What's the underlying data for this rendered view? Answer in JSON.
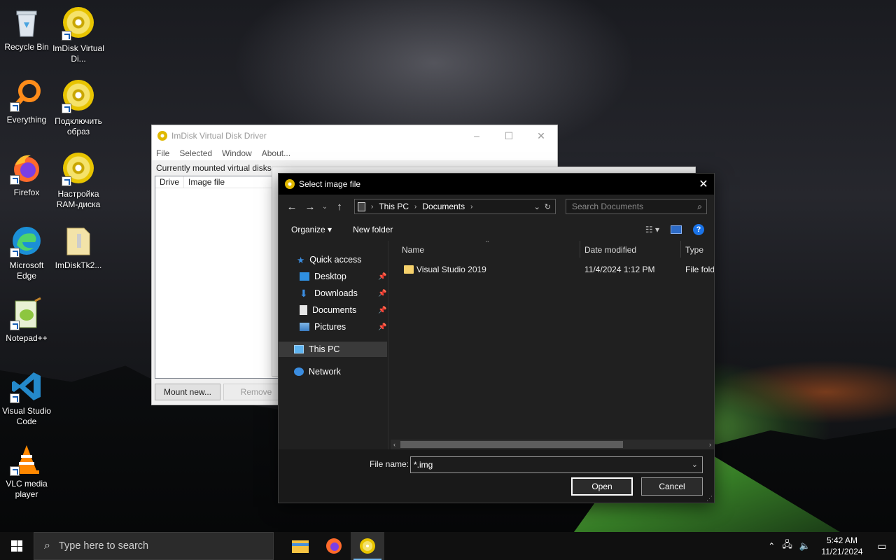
{
  "desktop_icons": [
    {
      "label": "Recycle Bin",
      "icon": "recycle-bin-icon"
    },
    {
      "label": "ImDisk Virtual Di...",
      "icon": "imdisk-disc-icon"
    },
    {
      "label": "Everything",
      "icon": "everything-icon"
    },
    {
      "label": "Подключить образ",
      "icon": "imdisk-disc-icon"
    },
    {
      "label": "Firefox",
      "icon": "firefox-icon"
    },
    {
      "label": "Настройка RAM-диска",
      "icon": "imdisk-disc-icon"
    },
    {
      "label": "Microsoft Edge",
      "icon": "edge-icon"
    },
    {
      "label": "ImDiskTk2...",
      "icon": "zip-folder-icon"
    },
    {
      "label": "Notepad++",
      "icon": "notepadpp-icon"
    },
    {
      "label": "Visual Studio Code",
      "icon": "vscode-icon"
    },
    {
      "label": "VLC media player",
      "icon": "vlc-icon"
    }
  ],
  "imdisk_window": {
    "title": "ImDisk Virtual Disk Driver",
    "menu": [
      "File",
      "Selected",
      "Window",
      "About..."
    ],
    "section_label": "Currently mounted virtual disks",
    "columns": [
      "Drive",
      "Image file"
    ],
    "buttons": {
      "mount": "Mount new...",
      "remove": "Remove"
    }
  },
  "dialog": {
    "title": "Select image file",
    "breadcrumb": [
      "This PC",
      "Documents"
    ],
    "search_placeholder": "Search Documents",
    "toolbar": {
      "organize": "Organize",
      "new_folder": "New folder"
    },
    "nav": {
      "quick_access": "Quick access",
      "items": [
        "Desktop",
        "Downloads",
        "Documents",
        "Pictures"
      ],
      "this_pc": "This PC",
      "network": "Network"
    },
    "columns": {
      "name": "Name",
      "date": "Date modified",
      "type": "Type"
    },
    "files": [
      {
        "name": "Visual Studio 2019",
        "date": "11/4/2024 1:12 PM",
        "type": "File fold"
      }
    ],
    "file_name_label": "File name:",
    "file_name_value": "*.img",
    "open_label": "Open",
    "cancel_label": "Cancel"
  },
  "taskbar": {
    "search_placeholder": "Type here to search",
    "time": "5:42 AM",
    "date": "11/21/2024"
  },
  "colors": {
    "accent": "#76b9ed",
    "dialog_bg": "#202020",
    "help_blue": "#1a73e8"
  }
}
